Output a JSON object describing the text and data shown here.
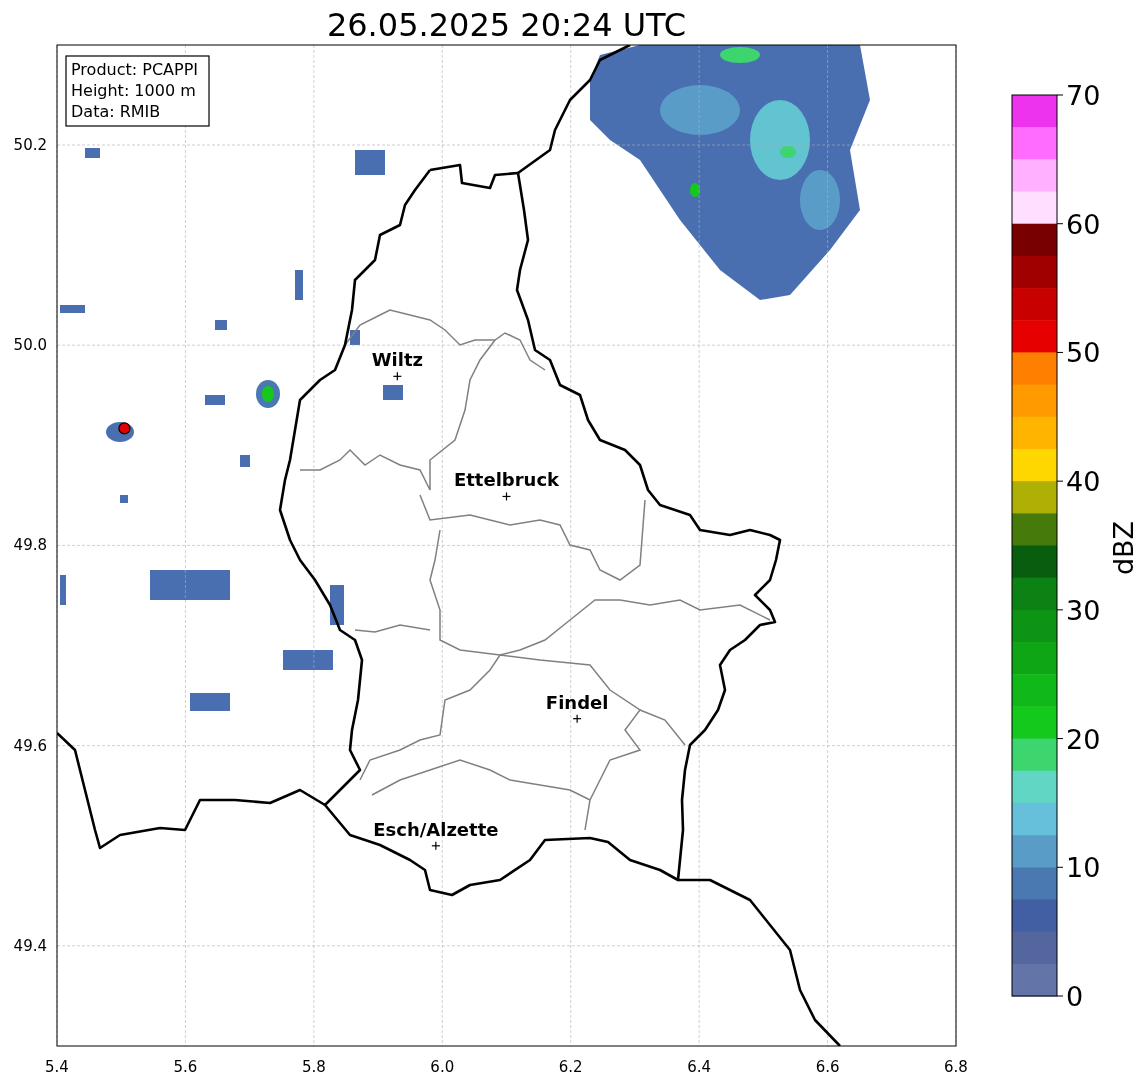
{
  "title": "26.05.2025 20:24 UTC",
  "info_box": [
    "Product: PCAPPI",
    "Height: 1000 m",
    "Data: RMIB"
  ],
  "map": {
    "x_ticks": [
      "5.4",
      "5.6",
      "5.8",
      "6.0",
      "6.2",
      "6.4",
      "6.6",
      "6.8"
    ],
    "y_ticks": [
      "50.2",
      "50.0",
      "49.8",
      "49.6",
      "49.4"
    ],
    "cities": [
      {
        "name": "Wiltz"
      },
      {
        "name": "Ettelbruck"
      },
      {
        "name": "Findel"
      },
      {
        "name": "Esch/Alzette"
      }
    ]
  },
  "colorbar": {
    "label": "dBZ",
    "ticks": [
      "70",
      "60",
      "50",
      "40",
      "30",
      "20",
      "10",
      "0"
    ],
    "bands": [
      {
        "color": "#ee33ee"
      },
      {
        "color": "#ff6cff"
      },
      {
        "color": "#ffb0ff"
      },
      {
        "color": "#ffdfff"
      },
      {
        "color": "#780000"
      },
      {
        "color": "#a00000"
      },
      {
        "color": "#c80000"
      },
      {
        "color": "#e60000"
      },
      {
        "color": "#ff7f00"
      },
      {
        "color": "#ff9a00"
      },
      {
        "color": "#ffb400"
      },
      {
        "color": "#ffd700"
      },
      {
        "color": "#aeb005"
      },
      {
        "color": "#467a0a"
      },
      {
        "color": "#085e0e"
      },
      {
        "color": "#0b8213"
      },
      {
        "color": "#0d9415"
      },
      {
        "color": "#0fa615"
      },
      {
        "color": "#10b81a"
      },
      {
        "color": "#13c91c"
      },
      {
        "color": "#3dd56e"
      },
      {
        "color": "#62d6c4"
      },
      {
        "color": "#66c0dc"
      },
      {
        "color": "#5a9cc8"
      },
      {
        "color": "#4a78b0"
      },
      {
        "color": "#435fa3"
      },
      {
        "color": "#53679e"
      },
      {
        "color": "#6374a8"
      }
    ]
  }
}
